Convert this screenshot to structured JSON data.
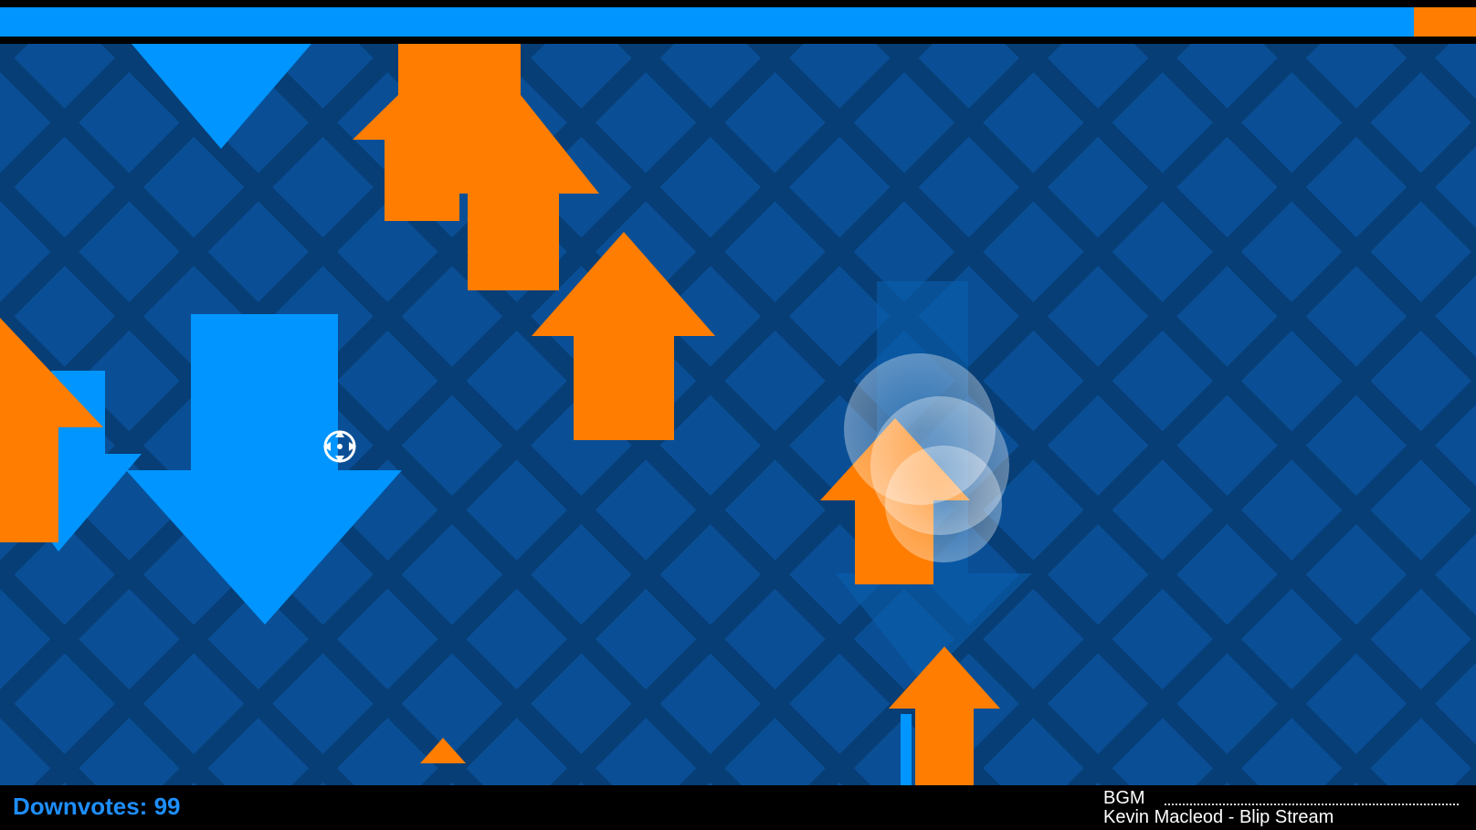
{
  "hud": {
    "downvotes_text": "Downvotes: 99",
    "bgm_label": "BGM",
    "bgm_track": "Kevin Macleod - Blip Stream",
    "progress_fraction_blue": 0.958
  },
  "colors": {
    "background": "#0a4f96",
    "grid": "#073e76",
    "upvote": "#ff7d00",
    "downvote": "#0095ff",
    "bar": "#000000",
    "hud_text": "#1e8fff"
  },
  "sprites": {
    "arrow_up_orange": "upvote-arrow",
    "arrow_down_blue": "downvote-arrow",
    "crosshair": "crosshair-icon",
    "bubble": "shield-bubble"
  }
}
